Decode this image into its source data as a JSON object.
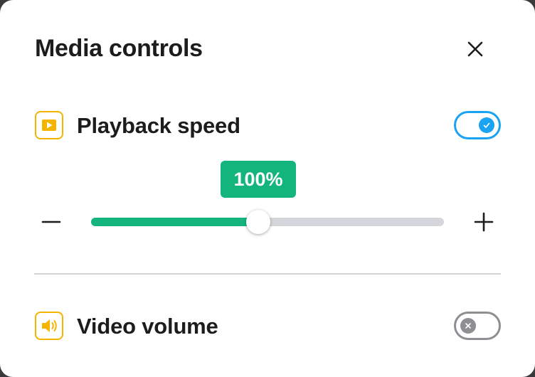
{
  "dialog": {
    "title": "Media controls"
  },
  "playback": {
    "label": "Playback speed",
    "enabled": true,
    "value_label": "100%",
    "slider_fraction": 0.474
  },
  "volume": {
    "label": "Video volume",
    "enabled": false
  },
  "icons": {
    "close": "close-icon",
    "playback": "play-icon",
    "volume": "speaker-icon",
    "minus": "minus-icon",
    "plus": "plus-icon",
    "check": "check-icon",
    "x": "x-icon"
  },
  "colors": {
    "accent_green": "#13b57d",
    "toggle_on": "#1aa3f0",
    "toggle_off": "#8e8e93",
    "icon_yellow": "#f5b400"
  }
}
